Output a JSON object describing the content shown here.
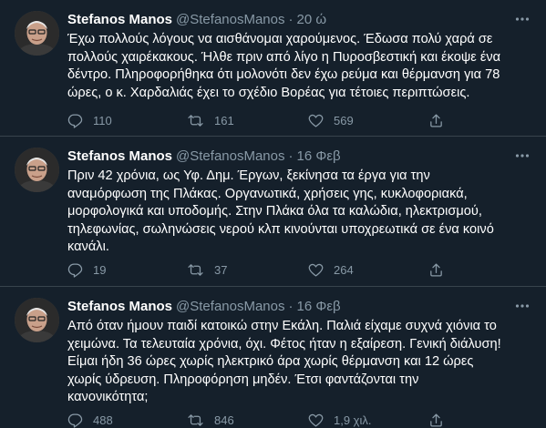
{
  "tweets": [
    {
      "name": "Stefanos Manos",
      "handle": "@StefanosManos",
      "separator": "·",
      "time": "20 ώ",
      "lines": [
        "Έχω πολλούς λόγους να αισθάνομαι χαρούμενος. Έδωσα πολύ χαρά σε",
        "πολλούς χαιρέκακους. Ήλθε πριν από λίγο η Πυροσβεστική και έκοψε ένα",
        "δέντρο. Πληροφορήθηκα ότι μολονότι δεν έχω ρεύμα και θέρμανση για 78",
        "ώρες, ο κ. Χαρδαλιάς έχει το σχέδιο Βορέας για τέτοιες περιπτώσεις."
      ],
      "replies": "110",
      "retweets": "161",
      "likes": "569"
    },
    {
      "name": "Stefanos Manos",
      "handle": "@StefanosManos",
      "separator": "·",
      "time": "16 Φεβ",
      "lines": [
        "Πριν 42 χρόνια, ως Υφ. Δημ. Έργων, ξεκίνησα τα έργα για την",
        "αναμόρφωση της Πλάκας. Οργανωτικά, χρήσεις γης, κυκλοφοριακά,",
        "μορφολογικά και υποδομής. Στην Πλάκα όλα τα καλώδια, ηλεκτρισμού,",
        "τηλεφωνίας, σωληνώσεις νερού κλπ κινούνται υποχρεωτικά σε ένα κοινό",
        "κανάλι."
      ],
      "replies": "19",
      "retweets": "37",
      "likes": "264"
    },
    {
      "name": "Stefanos Manos",
      "handle": "@StefanosManos",
      "separator": "·",
      "time": "16 Φεβ",
      "lines": [
        "Από όταν ήμουν παιδί κατοικώ στην Εκάλη. Παλιά είχαμε συχνά χιόνια το",
        "χειμώνα. Τα τελευταία χρόνια, όχι. Φέτος ήταν η εξαίρεση. Γενική διάλυση!",
        "Είμαι ήδη 36 ώρες χωρίς ηλεκτρικό άρα χωρίς θέρμανση και 12 ώρες",
        "χωρίς ύδρευση. Πληροφόρηση μηδέν. Έτσι φαντάζονται την",
        "κανονικότητα;"
      ],
      "replies": "488",
      "retweets": "846",
      "likes": "1,9 χιλ."
    }
  ],
  "icons": {
    "reply": "reply-icon",
    "retweet": "retweet-icon",
    "like": "heart-icon",
    "share": "share-icon",
    "more": "more-icon"
  },
  "colors": {
    "background": "#15202b",
    "divider": "#38444d",
    "secondary_text": "#8899a6",
    "primary_text": "#ffffff"
  }
}
